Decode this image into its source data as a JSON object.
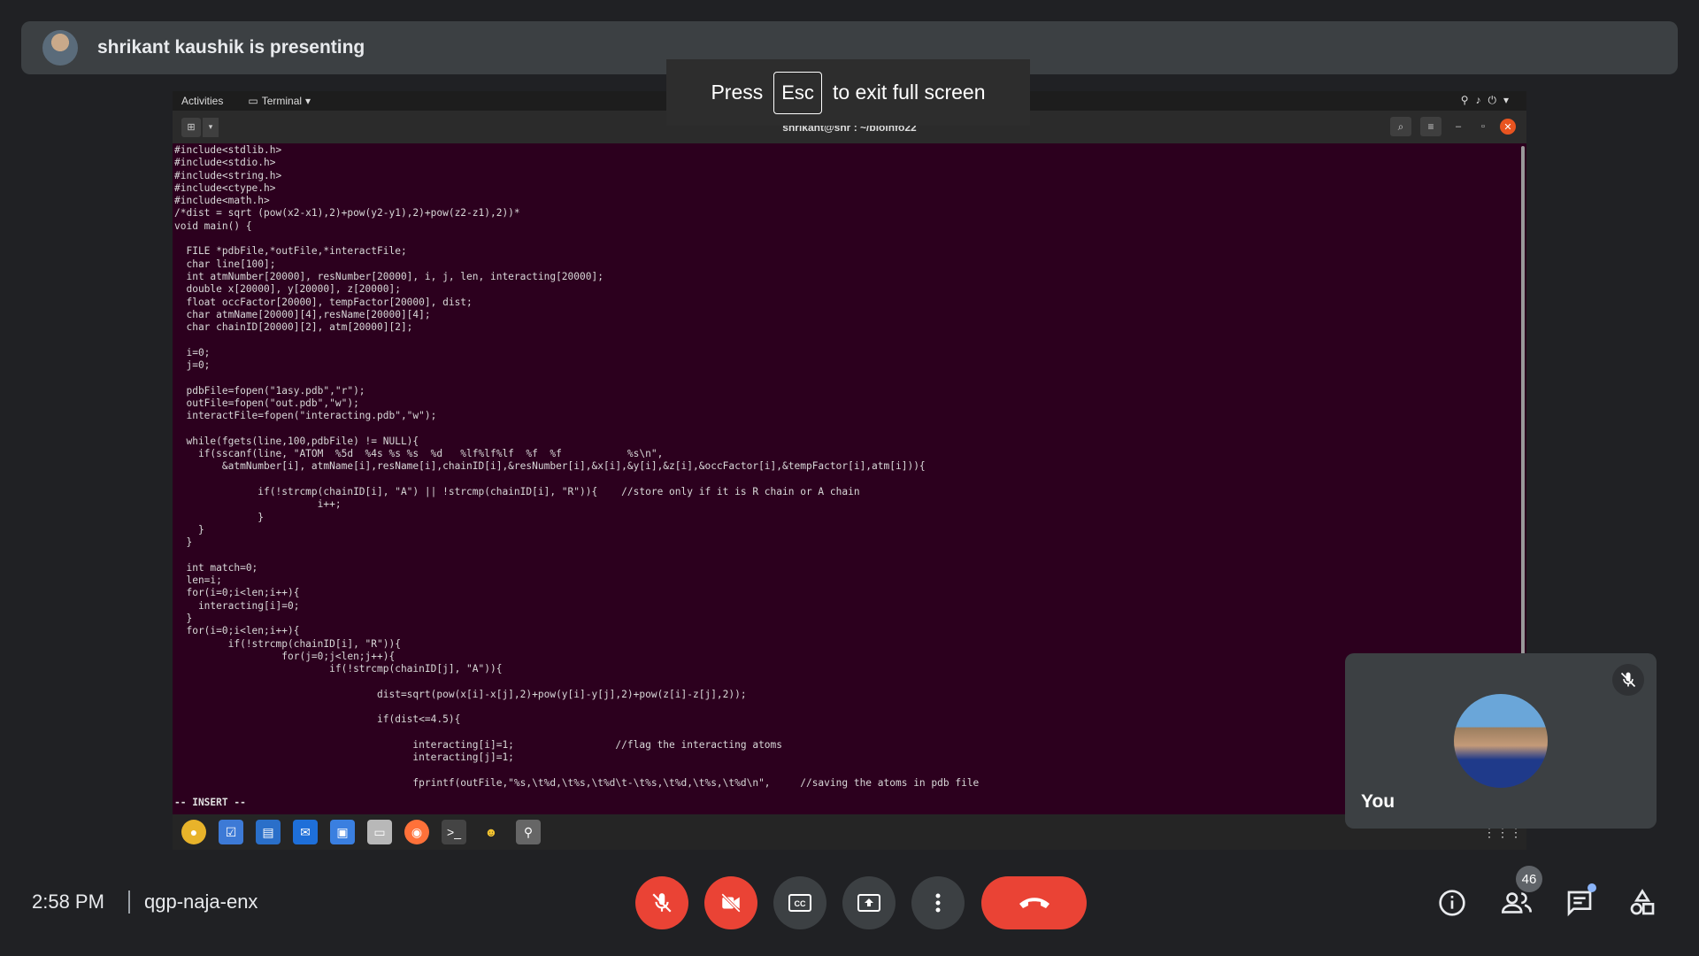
{
  "banner": {
    "text": "shrikant kaushik is presenting"
  },
  "fullscreen_notice": {
    "press": "Press",
    "key": "Esc",
    "rest": "to exit full screen"
  },
  "desktop": {
    "activities": "Activities",
    "terminal_menu": "Terminal",
    "window_title": "shrikant@shr       : ~/bioinfo22",
    "mode_line": "-- INSERT --",
    "code_lines": [
      "#include<stdlib.h>",
      "#include<stdio.h>",
      "#include<string.h>",
      "#include<ctype.h>",
      "#include<math.h>",
      "/*dist = sqrt (pow(x2-x1),2)+pow(y2-y1),2)+pow(z2-z1),2))*",
      "void main() {",
      "",
      "  FILE *pdbFile,*outFile,*interactFile;",
      "  char line[100];",
      "  int atmNumber[20000], resNumber[20000], i, j, len, interacting[20000];",
      "  double x[20000], y[20000], z[20000];",
      "  float occFactor[20000], tempFactor[20000], dist;",
      "  char atmName[20000][4],resName[20000][4];",
      "  char chainID[20000][2], atm[20000][2];",
      "",
      "  i=0;",
      "  j=0;",
      "",
      "  pdbFile=fopen(\"1asy.pdb\",\"r\");",
      "  outFile=fopen(\"out.pdb\",\"w\");",
      "  interactFile=fopen(\"interacting.pdb\",\"w\");",
      "",
      "  while(fgets(line,100,pdbFile) != NULL){",
      "    if(sscanf(line, \"ATOM  %5d  %4s %s %s  %d   %lf%lf%lf  %f  %f           %s\\n\",",
      "        &atmNumber[i], atmName[i],resName[i],chainID[i],&resNumber[i],&x[i],&y[i],&z[i],&occFactor[i],&tempFactor[i],atm[i])){",
      "",
      "              if(!strcmp(chainID[i], \"A\") || !strcmp(chainID[i], \"R\")){    //store only if it is R chain or A chain",
      "                        i++;",
      "              }",
      "    }",
      "  }",
      "",
      "  int match=0;",
      "  len=i;",
      "  for(i=0;i<len;i++){",
      "    interacting[i]=0;",
      "  }",
      "  for(i=0;i<len;i++){",
      "         if(!strcmp(chainID[i], \"R\")){",
      "                  for(j=0;j<len;j++){",
      "                          if(!strcmp(chainID[j], \"A\")){",
      "",
      "                                  dist=sqrt(pow(x[i]-x[j],2)+pow(y[i]-y[j],2)+pow(z[i]-z[j],2));",
      "",
      "                                  if(dist<=4.5){",
      "",
      "                                        interacting[i]=1;                 //flag the interacting atoms",
      "                                        interacting[j]=1;",
      "",
      "                                        fprintf(outFile,\"%s,\\t%d,\\t%s,\\t%d\\t-\\t%s,\\t%d,\\t%s,\\t%d\\n\",     //saving the atoms in pdb file"
    ]
  },
  "self_tile": {
    "name": "You"
  },
  "bottom": {
    "time": "2:58 PM",
    "meeting_code": "qgp-naja-enx",
    "participants_count": "46"
  },
  "colors": {
    "red": "#ea4335",
    "grey": "#3c4043",
    "terminal_bg": "#2c001e"
  },
  "icons": [
    "mic-off-icon",
    "camera-off-icon",
    "captions-icon",
    "present-icon",
    "more-icon",
    "end-call-icon",
    "info-icon",
    "people-icon",
    "chat-icon",
    "activities-icon"
  ]
}
